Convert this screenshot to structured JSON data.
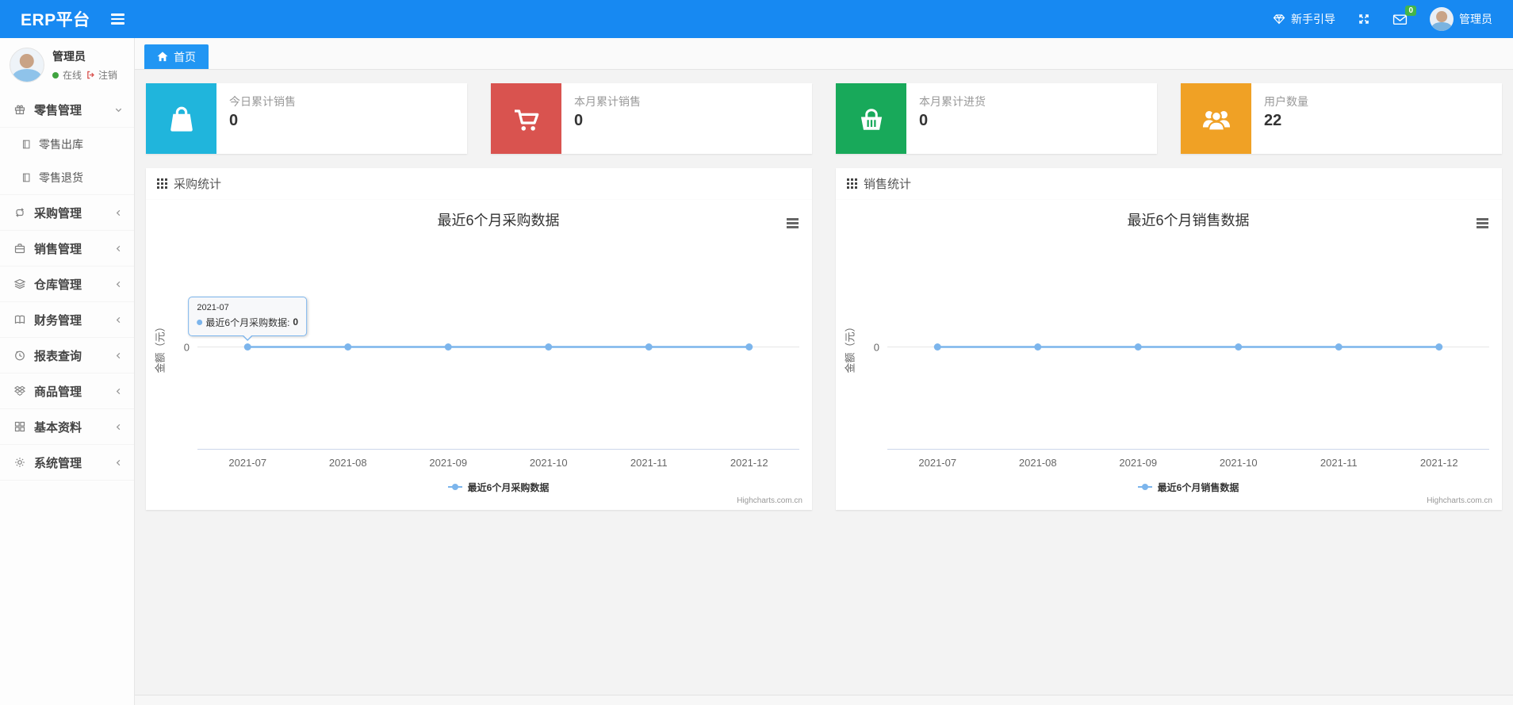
{
  "navbar": {
    "brand": "ERP平台",
    "guide_label": "新手引导",
    "mail_badge": "0",
    "user_name": "管理员",
    "bg_color": "#1789f2",
    "icons": [
      "menu-bars-icon",
      "gem-icon",
      "fullscreen-icon",
      "mail-icon",
      "avatar"
    ]
  },
  "sidebar": {
    "user": {
      "name": "管理员",
      "status": "在线",
      "logout_label": "注销"
    },
    "menu": [
      {
        "label": "零售管理",
        "icon": "gift-icon",
        "state": "expanded",
        "children": [
          {
            "label": "零售出库",
            "icon": "journal-icon"
          },
          {
            "label": "零售退货",
            "icon": "journal-icon"
          }
        ]
      },
      {
        "label": "采购管理",
        "icon": "repeat-icon",
        "state": "collapsed"
      },
      {
        "label": "销售管理",
        "icon": "briefcase-icon",
        "state": "collapsed"
      },
      {
        "label": "仓库管理",
        "icon": "layers-icon",
        "state": "collapsed"
      },
      {
        "label": "财务管理",
        "icon": "open-book-icon",
        "state": "collapsed"
      },
      {
        "label": "报表查询",
        "icon": "clock-icon",
        "state": "collapsed"
      },
      {
        "label": "商品管理",
        "icon": "box-icon",
        "state": "collapsed"
      },
      {
        "label": "基本资料",
        "icon": "grid-icon",
        "state": "collapsed"
      },
      {
        "label": "系统管理",
        "icon": "gear-icon",
        "state": "collapsed"
      }
    ]
  },
  "tabs": {
    "home_label": "首页",
    "active_color": "#2196f3"
  },
  "stats": [
    {
      "label": "今日累计销售",
      "value": "0",
      "color": "#20b5dc",
      "icon": "shopping-bag-icon"
    },
    {
      "label": "本月累计销售",
      "value": "0",
      "color": "#d9534f",
      "icon": "shopping-cart-icon"
    },
    {
      "label": "本月累计进货",
      "value": "0",
      "color": "#18a95a",
      "icon": "shopping-basket-icon"
    },
    {
      "label": "用户数量",
      "value": "22",
      "color": "#f0a125",
      "icon": "users-icon"
    }
  ],
  "panels": [
    {
      "header": "采购统计",
      "icon": "grid-th-icon"
    },
    {
      "header": "销售统计",
      "icon": "grid-th-icon"
    }
  ],
  "chart_data": [
    {
      "type": "line",
      "title": "最近6个月采购数据",
      "categories": [
        "2021-07",
        "2021-08",
        "2021-09",
        "2021-10",
        "2021-11",
        "2021-12"
      ],
      "series": [
        {
          "name": "最近6个月采购数据",
          "values": [
            0,
            0,
            0,
            0,
            0,
            0
          ]
        }
      ],
      "ylabel": "金额（元）",
      "y_ticks": [
        "0"
      ],
      "ylim": [
        -1,
        1
      ],
      "grid": false,
      "legend_position": "bottom",
      "line_color": "#7cb5ec",
      "credit": "Highcharts.com.cn",
      "tooltip": {
        "header": "2021-07",
        "label": "最近6个月采购数据:",
        "value": "0"
      }
    },
    {
      "type": "line",
      "title": "最近6个月销售数据",
      "categories": [
        "2021-07",
        "2021-08",
        "2021-09",
        "2021-10",
        "2021-11",
        "2021-12"
      ],
      "series": [
        {
          "name": "最近6个月销售数据",
          "values": [
            0,
            0,
            0,
            0,
            0,
            0
          ]
        }
      ],
      "ylabel": "金额（元）",
      "y_ticks": [
        "0"
      ],
      "ylim": [
        -1,
        1
      ],
      "grid": false,
      "legend_position": "bottom",
      "line_color": "#7cb5ec",
      "credit": "Highcharts.com.cn"
    }
  ]
}
